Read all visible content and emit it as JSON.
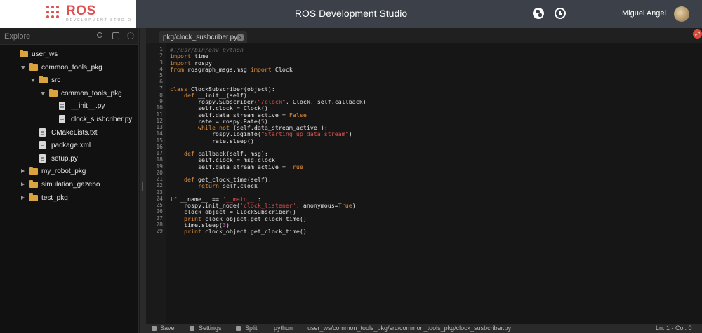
{
  "header": {
    "logo_text": "ROS",
    "logo_subtext": "DEVELOPMENT STUDIO",
    "app_title": "ROS Development Studio",
    "user_name": "Miguel Angel",
    "icons": [
      "globe-icon",
      "clock-icon",
      "avatar"
    ]
  },
  "sidebar": {
    "title": "Explore",
    "tools": [
      "search-icon",
      "package-icon",
      "gear-icon"
    ],
    "tree": [
      {
        "label": "user_ws",
        "type": "folder",
        "arrow": "none"
      },
      {
        "label": "common_tools_pkg",
        "type": "folder",
        "arrow": "down"
      },
      {
        "label": "src",
        "type": "folder",
        "arrow": "down"
      },
      {
        "label": "common_tools_pkg",
        "type": "folder",
        "arrow": "down"
      },
      {
        "label": "__init__.py",
        "type": "file",
        "arrow": "none"
      },
      {
        "label": "clock_susbcriber.py",
        "type": "file",
        "arrow": "none"
      },
      {
        "label": "CMakeLists.txt",
        "type": "file",
        "arrow": "none"
      },
      {
        "label": "package.xml",
        "type": "file",
        "arrow": "none"
      },
      {
        "label": "setup.py",
        "type": "file",
        "arrow": "none"
      },
      {
        "label": "my_robot_pkg",
        "type": "folder",
        "arrow": "right"
      },
      {
        "label": "simulation_gazebo",
        "type": "folder",
        "arrow": "right"
      },
      {
        "label": "test_pkg",
        "type": "folder",
        "arrow": "right"
      }
    ]
  },
  "editor": {
    "tab_label": "pkg/clock_susbcriber.py",
    "tab_close": "x",
    "code_lines": [
      "#!/usr/bin/env python",
      "import time",
      "import rospy",
      "from rosgraph_msgs.msg import Clock",
      "",
      "",
      "class ClockSubscriber(object):",
      "    def __init__(self):",
      "        rospy.Subscriber(\"/clock\", Clock, self.callback)",
      "        self.clock = Clock()",
      "        self.data_stream_active = False",
      "        rate = rospy.Rate(5)",
      "        while not (self.data_stream_active ):",
      "            rospy.loginfo(\"Starting up data stream\")",
      "            rate.sleep()",
      "",
      "    def callback(self, msg):",
      "        self.clock = msg.clock",
      "        self.data_stream_active = True",
      "",
      "    def get_clock_time(self):",
      "        return self.clock",
      "",
      "if __name__ == '__main__':",
      "    rospy.init_node('clock_listener', anonymous=True)",
      "    clock_object = ClockSubscriber()",
      "    print clock_object.get_clock_time()",
      "    time.sleep(3)",
      "    print clock_object.get_clock_time()"
    ]
  },
  "statusbar": {
    "save": "Save",
    "settings": "Settings",
    "split": "Split",
    "language": "python",
    "path": "user_ws/common_tools_pkg/src/common_tools_pkg/clock_susbcriber.py",
    "position": "Ln: 1 - Col: 0"
  },
  "colors": {
    "header_bg": "#3b4049",
    "keyword": "#e08c3a",
    "string": "#d85050",
    "folder": "#d9a440",
    "close_button": "#d64b3c"
  }
}
